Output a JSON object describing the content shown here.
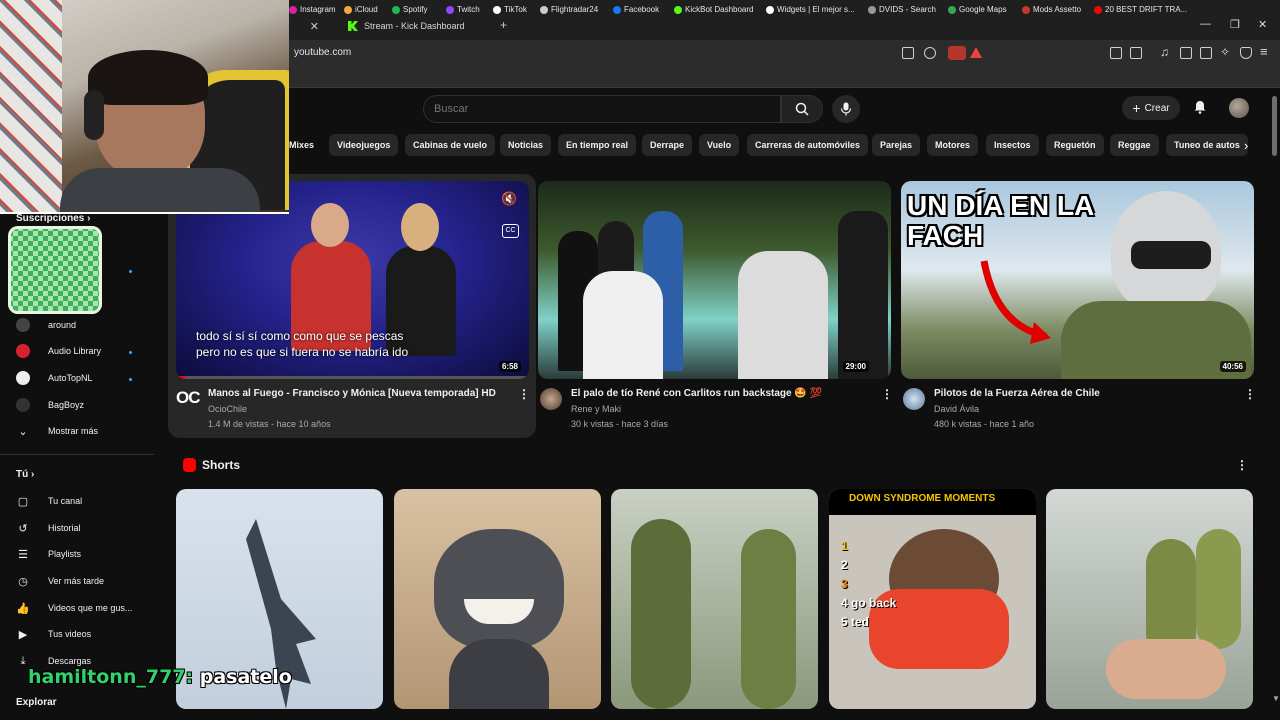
{
  "browser": {
    "tabs": [
      {
        "label": "Stream - Kick Dashboard",
        "icon": "kick-icon"
      }
    ],
    "url": "youtube.com",
    "bookmarks": [
      {
        "label": "Instagram",
        "color": "#d6249f"
      },
      {
        "label": "iCloud",
        "color": "#f4a742"
      },
      {
        "label": "Spotify",
        "color": "#1db954"
      },
      {
        "label": "Twitch",
        "color": "#9146ff"
      },
      {
        "label": "TikTok",
        "color": "#ffffff"
      },
      {
        "label": "Flightradar24",
        "color": "#cccccc"
      },
      {
        "label": "Facebook",
        "color": "#1877f2"
      },
      {
        "label": "KickBot Dashboard",
        "color": "#53fc18"
      },
      {
        "label": "Widgets | El mejor s...",
        "color": "#ffffff"
      },
      {
        "label": "DVIDS - Search",
        "color": "#999999"
      },
      {
        "label": "Google Maps",
        "color": "#34a853"
      },
      {
        "label": "Mods Assetto",
        "color": "#c0392b"
      },
      {
        "label": "20 BEST DRIFT TRA...",
        "color": "#ff0000"
      }
    ]
  },
  "header": {
    "search_placeholder": "Buscar",
    "create_label": "Crear"
  },
  "chips": [
    "Mixes",
    "Videojuegos",
    "Cabinas de vuelo",
    "Noticias",
    "En tiempo real",
    "Derrape",
    "Vuelo",
    "Carreras de automóviles",
    "Parejas",
    "Motores",
    "Insectos",
    "Reguetón",
    "Reggae",
    "Tuneo de autos"
  ],
  "sidebar": {
    "subscriptions_heading": "Suscripciones",
    "channels": [
      {
        "label": "around",
        "color": "#444444"
      },
      {
        "label": "Audio Library",
        "color": "#d6232f"
      },
      {
        "label": "AutoTopNL",
        "color": "#eeeeee"
      },
      {
        "label": "BagBoyz",
        "color": "#333333"
      }
    ],
    "show_more": "Mostrar más",
    "you_heading": "Tú",
    "you_items": [
      {
        "label": "Tu canal",
        "icon": "user-box-icon"
      },
      {
        "label": "Historial",
        "icon": "history-icon"
      },
      {
        "label": "Playlists",
        "icon": "playlist-icon"
      },
      {
        "label": "Ver más tarde",
        "icon": "clock-icon"
      },
      {
        "label": "Videos que me gus...",
        "icon": "thumbs-up-icon"
      },
      {
        "label": "Tus videos",
        "icon": "play-box-icon"
      },
      {
        "label": "Descargas",
        "icon": "download-icon"
      }
    ],
    "explore_heading": "Explorar"
  },
  "videos": [
    {
      "title": "Manos al Fuego - Francisco y Mónica [Nueva temporada] HD",
      "channel": "OcioChile",
      "meta": "1.4 M de vistas - hace 10 años",
      "duration": "6:58",
      "caption_line1": "todo sí sí sí como como que se pescas",
      "caption_line2": "pero no es que si fuera no se habría ido",
      "channel_mark": "OC"
    },
    {
      "title": "El palo de tío René con Carlitos run backstage 🤩 💯",
      "channel": "Rene y Maki",
      "meta": "30 k vistas - hace 3 días",
      "duration": "29:00"
    },
    {
      "title": "Pilotos de la Fuerza Aérea de Chile",
      "channel": "David Ávila",
      "meta": "480 k vistas - hace 1 año",
      "duration": "40:56",
      "thumb_text": "UN DÍA EN LA FACH"
    }
  ],
  "shorts": {
    "heading": "Shorts",
    "items": [
      {
        "label": ""
      },
      {
        "label": ""
      },
      {
        "label": ""
      },
      {
        "label": "DOWN SYNDROME MOMENTS",
        "list": [
          "1",
          "2",
          "3",
          "4 go back",
          "5 ted"
        ]
      },
      {
        "label": ""
      }
    ]
  },
  "overlay": {
    "chat_user": "hamiltonn_777:",
    "chat_text": "pasatelo",
    "chat_user_color": "#33d16b"
  }
}
